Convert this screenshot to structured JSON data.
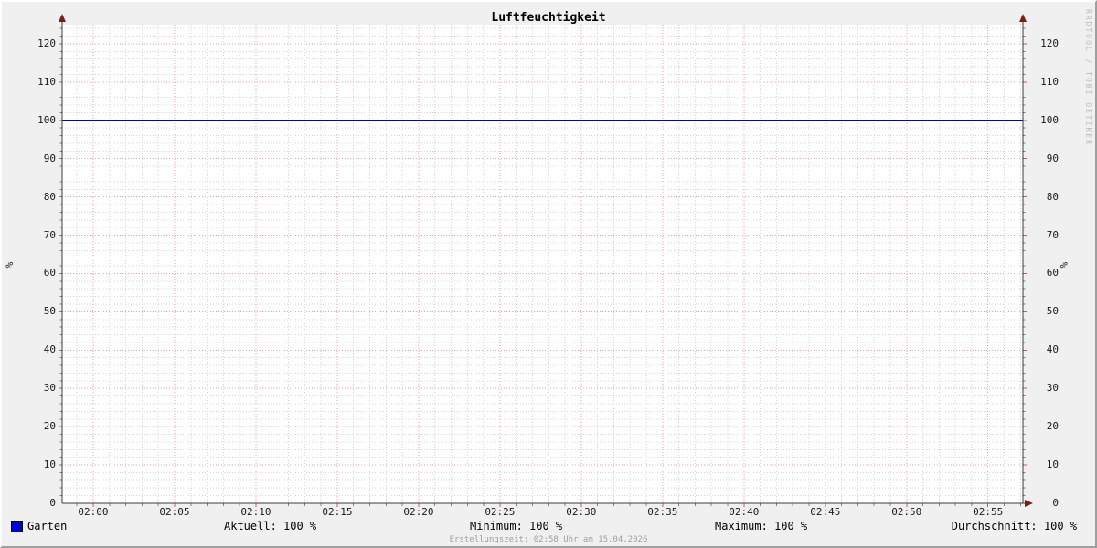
{
  "title": "Luftfeuchtigkeit",
  "watermark": "RRDTOOL / TOBI OETIKER",
  "y_axis_unit": "%",
  "footer": "Erstellungszeit: 02:58 Uhr am 15.04.2026",
  "legend": {
    "series_label": "Garten",
    "aktuell": "Aktuell: 100 %",
    "minimum": "Minimum: 100 %",
    "maximum": "Maximum: 100 %",
    "durchschnitt": "Durchschnitt: 100 %"
  },
  "colors": {
    "background": "#f0f0f0",
    "canvas": "#ffffff",
    "series_line": "#0000b8",
    "legend_swatch": "#0000cc",
    "major_grid": "#f0a0a0",
    "minor_grid": "#d4d4d4",
    "minor_tick": "#7f7f7f",
    "major_tick": "#c06060",
    "axis": "#3c3c3c",
    "arrow": "#7a1d1d",
    "watermark": "#bdbdbd",
    "footer_text": "#9e9e9e"
  },
  "chart_data": {
    "type": "line",
    "title": "Luftfeuchtigkeit",
    "xlabel": "",
    "ylabel": "%",
    "ylim": [
      0,
      125
    ],
    "y_major_step": 10,
    "y_minor_step": 2,
    "y_tick_labels": [
      "0",
      "10",
      "20",
      "30",
      "40",
      "50",
      "60",
      "70",
      "80",
      "90",
      "100",
      "110",
      "120"
    ],
    "x_start_min": -1.91,
    "x_end_min": 57.15,
    "x_major_step_min": 5,
    "x_minor_step_min": 1,
    "x_tick_labels": [
      "02:00",
      "02:05",
      "02:10",
      "02:15",
      "02:20",
      "02:25",
      "02:30",
      "02:35",
      "02:40",
      "02:45",
      "02:50",
      "02:55"
    ],
    "grid": true,
    "legend_position": "bottom",
    "series": [
      {
        "name": "Garten",
        "color": "#0000b8",
        "constant_value": 100
      }
    ],
    "stats": {
      "aktuell": 100,
      "minimum": 100,
      "maximum": 100,
      "durchschnitt": 100,
      "unit": "%"
    }
  }
}
